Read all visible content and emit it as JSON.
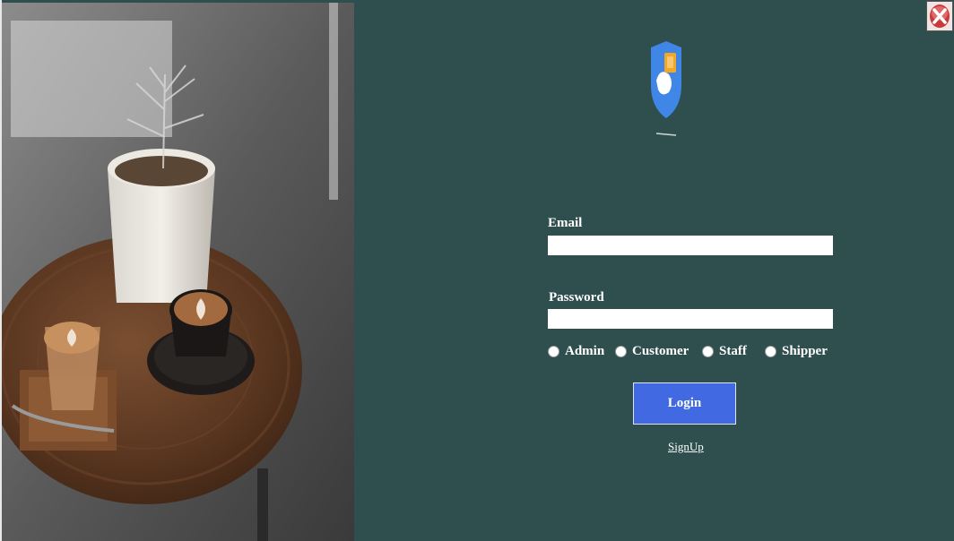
{
  "form": {
    "email_label": "Email",
    "email_value": "",
    "password_label": "Password",
    "password_value": "",
    "roles": [
      "Admin",
      "Customer",
      "Staff",
      "Shipper"
    ],
    "login_label": "Login",
    "signup_label": "SignUp"
  },
  "icons": {
    "close": "close-icon",
    "logo": "shield-logo-icon",
    "photo": "coffee-table-photo"
  },
  "colors": {
    "background": "#2f4f4f",
    "login_button": "#4169e1",
    "logo_shield": "#3f86e6"
  }
}
